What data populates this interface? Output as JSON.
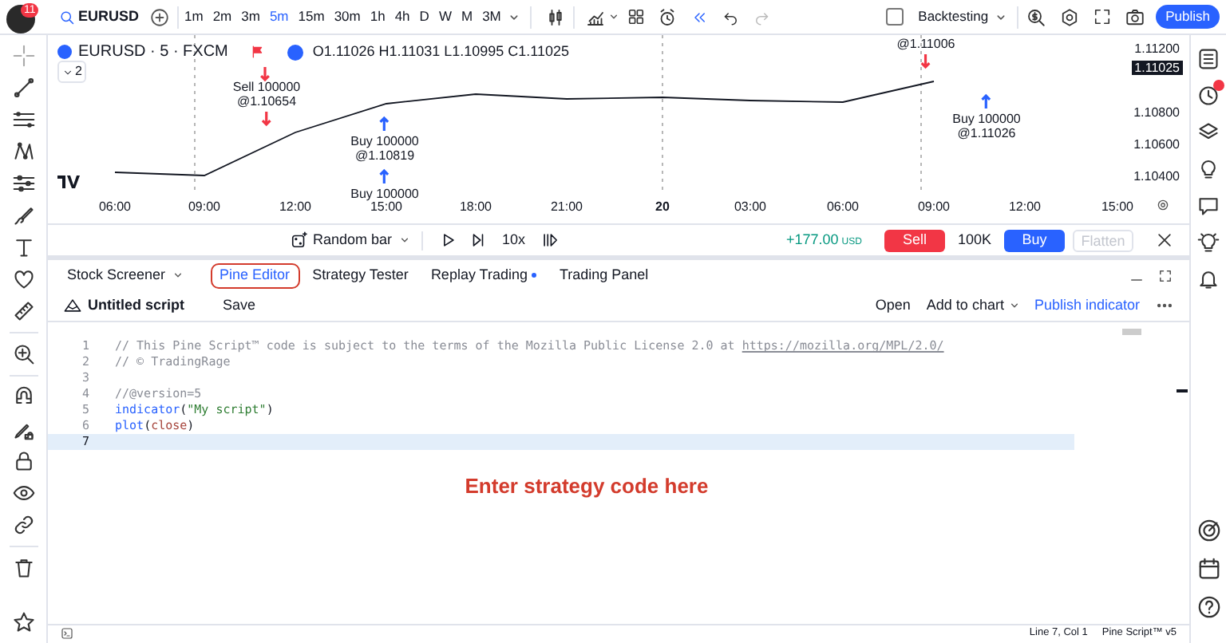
{
  "top_bar": {
    "avatar_badge": "11",
    "symbol": "EURUSD",
    "intervals": [
      {
        "label": "1m",
        "selected": false
      },
      {
        "label": "2m",
        "selected": false
      },
      {
        "label": "3m",
        "selected": false
      },
      {
        "label": "5m",
        "selected": true
      },
      {
        "label": "15m",
        "selected": false
      },
      {
        "label": "30m",
        "selected": false
      },
      {
        "label": "1h",
        "selected": false
      },
      {
        "label": "4h",
        "selected": false
      },
      {
        "label": "D",
        "selected": false
      },
      {
        "label": "W",
        "selected": false
      },
      {
        "label": "M",
        "selected": false
      },
      {
        "label": "3M",
        "selected": false
      }
    ],
    "backtesting": {
      "label": "Backtesting",
      "checked": false
    },
    "publish": "Publish"
  },
  "chart": {
    "legend": {
      "title": "EURUSD · 5 · FXCM",
      "ohlc": "O1.11026 H1.11031 L1.10995 C1.11025",
      "collapse": "2"
    },
    "chart_data": {
      "type": "line",
      "categories": [
        "06:00",
        "09:00",
        "12:00",
        "15:00",
        "18:00",
        "21:00",
        "20",
        "03:00",
        "06:00",
        "09:00",
        "12:00",
        "15:00"
      ],
      "series": [
        {
          "color": "#131722",
          "values": [
            1.1042,
            1.104,
            1.1067,
            1.1085,
            1.1091,
            1.1088,
            1.1089,
            1.1087,
            1.1086,
            1.1099,
            null,
            null
          ]
        }
      ],
      "ylim": [
        1.104,
        1.112
      ],
      "yticks": [
        {
          "value": 1.112,
          "label": "1.11200"
        },
        {
          "value": 1.108,
          "label": "1.10800"
        },
        {
          "value": 1.106,
          "label": "1.10600"
        },
        {
          "value": 1.104,
          "label": "1.10400"
        }
      ]
    },
    "current_price": "1.11025",
    "trades": [
      {
        "kind": "sell"
      },
      {
        "kind": "sell",
        "lines": [
          "Sell 100000",
          "@1.10654"
        ]
      },
      {
        "kind": "buy",
        "lines": [
          "Buy 100000",
          "@1.10819"
        ]
      },
      {
        "kind": "buy",
        "lines": [
          "Buy 100000"
        ]
      },
      {
        "kind": "sell",
        "lines": [
          "@1.11006"
        ]
      },
      {
        "kind": "buy",
        "lines": [
          "Buy 100000",
          "@1.11026"
        ]
      }
    ],
    "time_label_styles": [
      {
        "bold": false
      },
      {
        "bold": false
      },
      {
        "bold": false
      },
      {
        "bold": false
      },
      {
        "bold": false
      },
      {
        "bold": false
      },
      {
        "bold": true
      },
      {
        "bold": false
      },
      {
        "bold": false
      },
      {
        "bold": false
      },
      {
        "bold": false
      },
      {
        "bold": false
      }
    ]
  },
  "replay_bar": {
    "mode": "Random bar",
    "speed": "10x",
    "pnl": "+177.00",
    "currency": "USD",
    "sell": "Sell",
    "quantity": "100K",
    "buy": "Buy",
    "flatten": {
      "label": "Flatten",
      "disabled": true
    }
  },
  "bottom_tabs": [
    {
      "label": "Stock Screener",
      "dropdown": true,
      "dot": false,
      "selected": false
    },
    {
      "label": "Pine Editor",
      "dropdown": false,
      "dot": false,
      "selected": true
    },
    {
      "label": "Strategy Tester",
      "dropdown": false,
      "dot": false,
      "selected": false
    },
    {
      "label": "Replay Trading",
      "dropdown": false,
      "dot": true,
      "selected": false
    },
    {
      "label": "Trading Panel",
      "dropdown": false,
      "dot": false,
      "selected": false
    }
  ],
  "editor": {
    "script_name": "Untitled script",
    "save": "Save",
    "open": "Open",
    "add_to_chart": "Add to chart",
    "publish": "Publish indicator",
    "lines": [
      {
        "number": "1",
        "selected": false,
        "tokens": [
          {
            "kind": "comment",
            "text": "// This Pine Script™ code is subject to the terms of the Mozilla Public License 2.0 at "
          },
          {
            "kind": "link",
            "text": "https://mozilla.org/MPL/2.0/"
          }
        ]
      },
      {
        "number": "2",
        "selected": false,
        "tokens": [
          {
            "kind": "comment",
            "text": "// © TradingRage"
          }
        ]
      },
      {
        "number": "3",
        "selected": false
      },
      {
        "number": "4",
        "selected": false,
        "tokens": [
          {
            "kind": "comment",
            "text": "//@version=5"
          }
        ]
      },
      {
        "number": "5",
        "selected": false,
        "tokens": [
          {
            "kind": "function",
            "text": "indicator"
          },
          {
            "kind": "plain",
            "text": "("
          },
          {
            "kind": "string",
            "text": "\"My script\""
          },
          {
            "kind": "plain",
            "text": ")"
          }
        ]
      },
      {
        "number": "6",
        "selected": false,
        "tokens": [
          {
            "kind": "function",
            "text": "plot"
          },
          {
            "kind": "plain",
            "text": "("
          },
          {
            "kind": "variable",
            "text": "close"
          },
          {
            "kind": "plain",
            "text": ")"
          }
        ]
      },
      {
        "number": "7",
        "selected": true
      }
    ],
    "annotation": "Enter strategy code here",
    "status": {
      "cursor": "Line 7, Col 1",
      "language": "Pine Script™ v5"
    }
  }
}
